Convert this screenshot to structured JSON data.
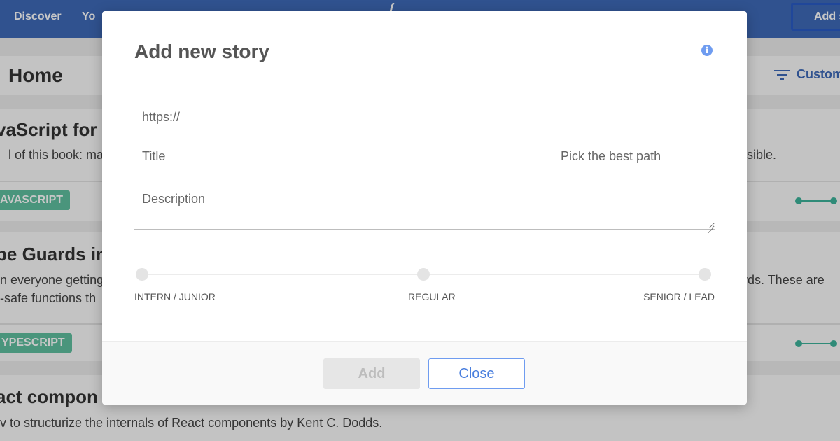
{
  "navbar": {
    "links": [
      "Discover",
      "Yo"
    ],
    "add_button_label": "Add s"
  },
  "home": {
    "title": "Home",
    "customize_label": "Custom"
  },
  "stories": [
    {
      "title": "vaScript for i",
      "text_left": "l of this book: ma",
      "text_right": "ssible.",
      "tag": "AVASCRIPT"
    },
    {
      "title": "pe Guards in",
      "text_left_1": "n everyone getting",
      "text_left_2": "-safe functions th",
      "text_right": "rds. These are",
      "tag": "YPESCRIPT"
    },
    {
      "title": "act compon",
      "text": "v to structurize the internals of React components by Kent C. Dodds."
    }
  ],
  "modal": {
    "title": "Add new story",
    "info_icon": "info-icon",
    "url_placeholder": "https://",
    "title_placeholder": "Title",
    "path_placeholder": "Pick the best path",
    "description_placeholder": "Description",
    "levels": [
      "INTERN / JUNIOR",
      "REGULAR",
      "SENIOR / LEAD"
    ],
    "add_label": "Add",
    "close_label": "Close"
  },
  "colors": {
    "navbar": "#3e6ab8",
    "tag": "#5fbf9f",
    "accent": "#6f9cf0"
  }
}
